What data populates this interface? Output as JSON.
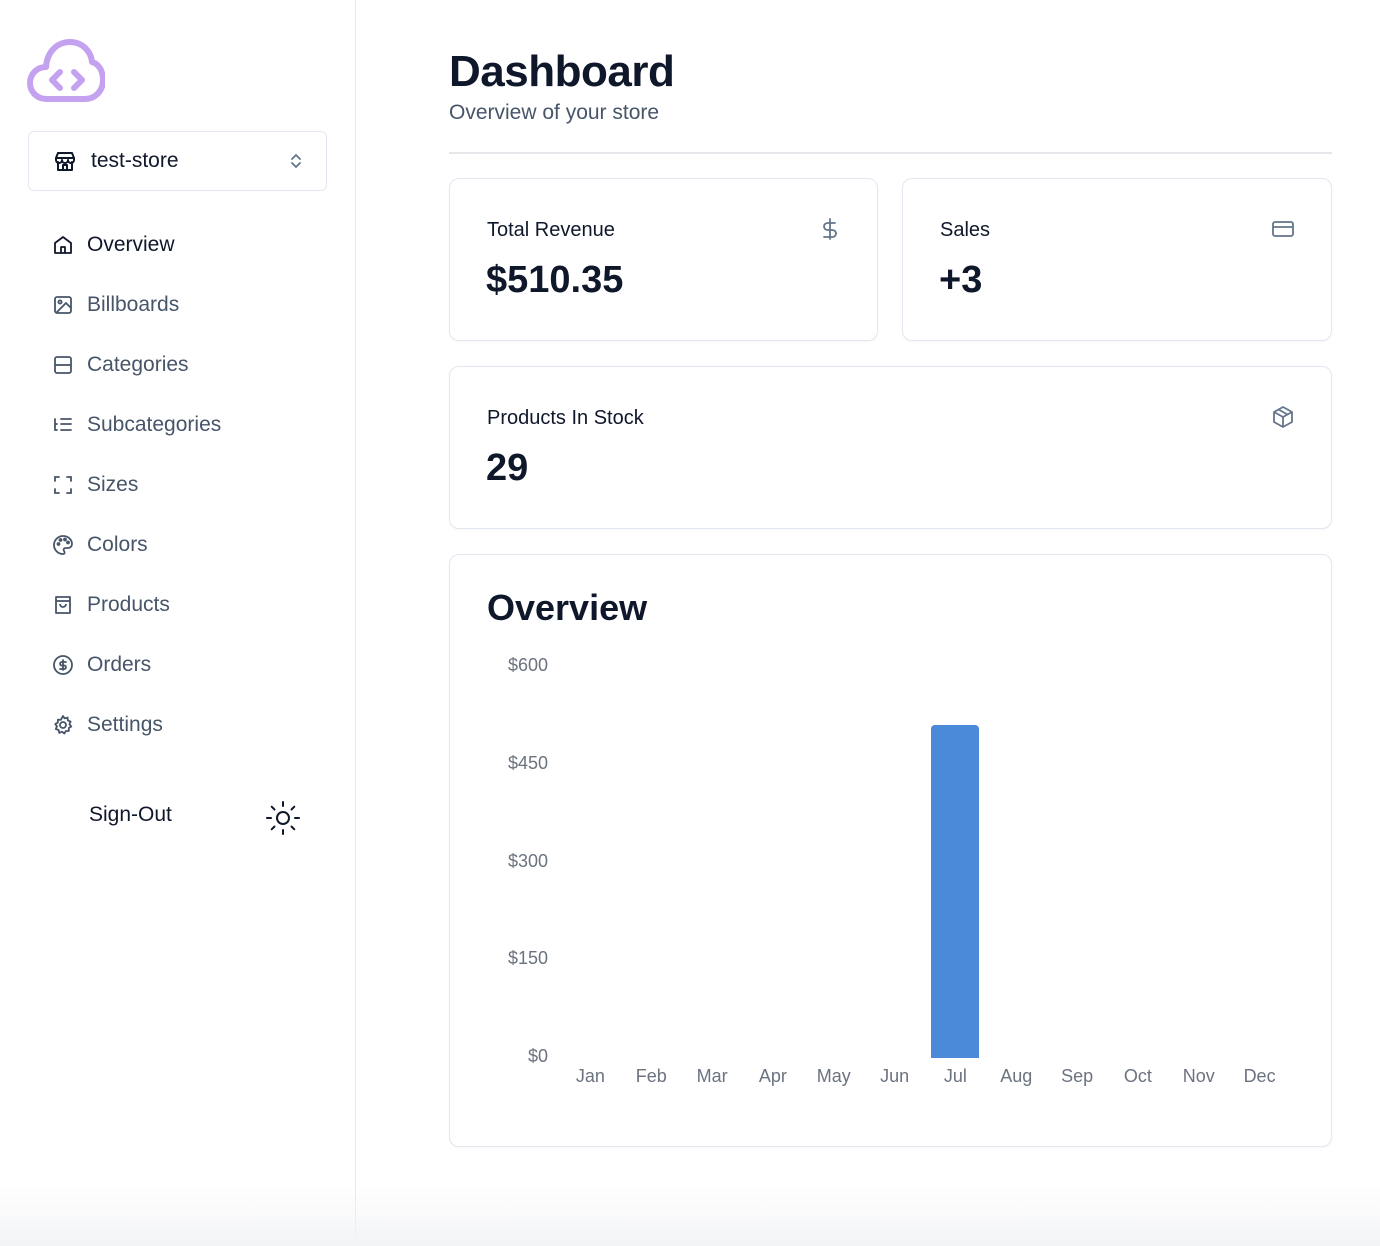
{
  "store": {
    "name": "test-store"
  },
  "nav": [
    {
      "label": "Overview",
      "icon": "home-icon",
      "active": true
    },
    {
      "label": "Billboards",
      "icon": "image-icon"
    },
    {
      "label": "Categories",
      "icon": "layout-icon"
    },
    {
      "label": "Subcategories",
      "icon": "list-tree-icon"
    },
    {
      "label": "Sizes",
      "icon": "scan-icon"
    },
    {
      "label": "Colors",
      "icon": "palette-icon"
    },
    {
      "label": "Products",
      "icon": "shopping-bag-icon"
    },
    {
      "label": "Orders",
      "icon": "dollar-circle-icon"
    },
    {
      "label": "Settings",
      "icon": "gear-icon"
    }
  ],
  "signout_label": "Sign-Out",
  "header": {
    "title": "Dashboard",
    "subtitle": "Overview of your store"
  },
  "cards": {
    "revenue": {
      "label": "Total Revenue",
      "value": "$510.35",
      "icon": "dollar-icon"
    },
    "sales": {
      "label": "Sales",
      "value": "+3",
      "icon": "credit-card-icon"
    },
    "stock": {
      "label": "Products In Stock",
      "value": "29",
      "icon": "package-icon"
    }
  },
  "overview_title": "Overview",
  "colors": {
    "accent": "#4a8ad8",
    "logo": "#c4a2f0"
  },
  "chart_data": {
    "type": "bar",
    "categories": [
      "Jan",
      "Feb",
      "Mar",
      "Apr",
      "May",
      "Jun",
      "Jul",
      "Aug",
      "Sep",
      "Oct",
      "Nov",
      "Dec"
    ],
    "values": [
      0,
      0,
      0,
      0,
      0,
      0,
      510.35,
      0,
      0,
      0,
      0,
      0
    ],
    "yticks": [
      "$600",
      "$450",
      "$300",
      "$150",
      "$0"
    ],
    "ylim": [
      0,
      600
    ],
    "grid": false,
    "title": "Overview"
  }
}
